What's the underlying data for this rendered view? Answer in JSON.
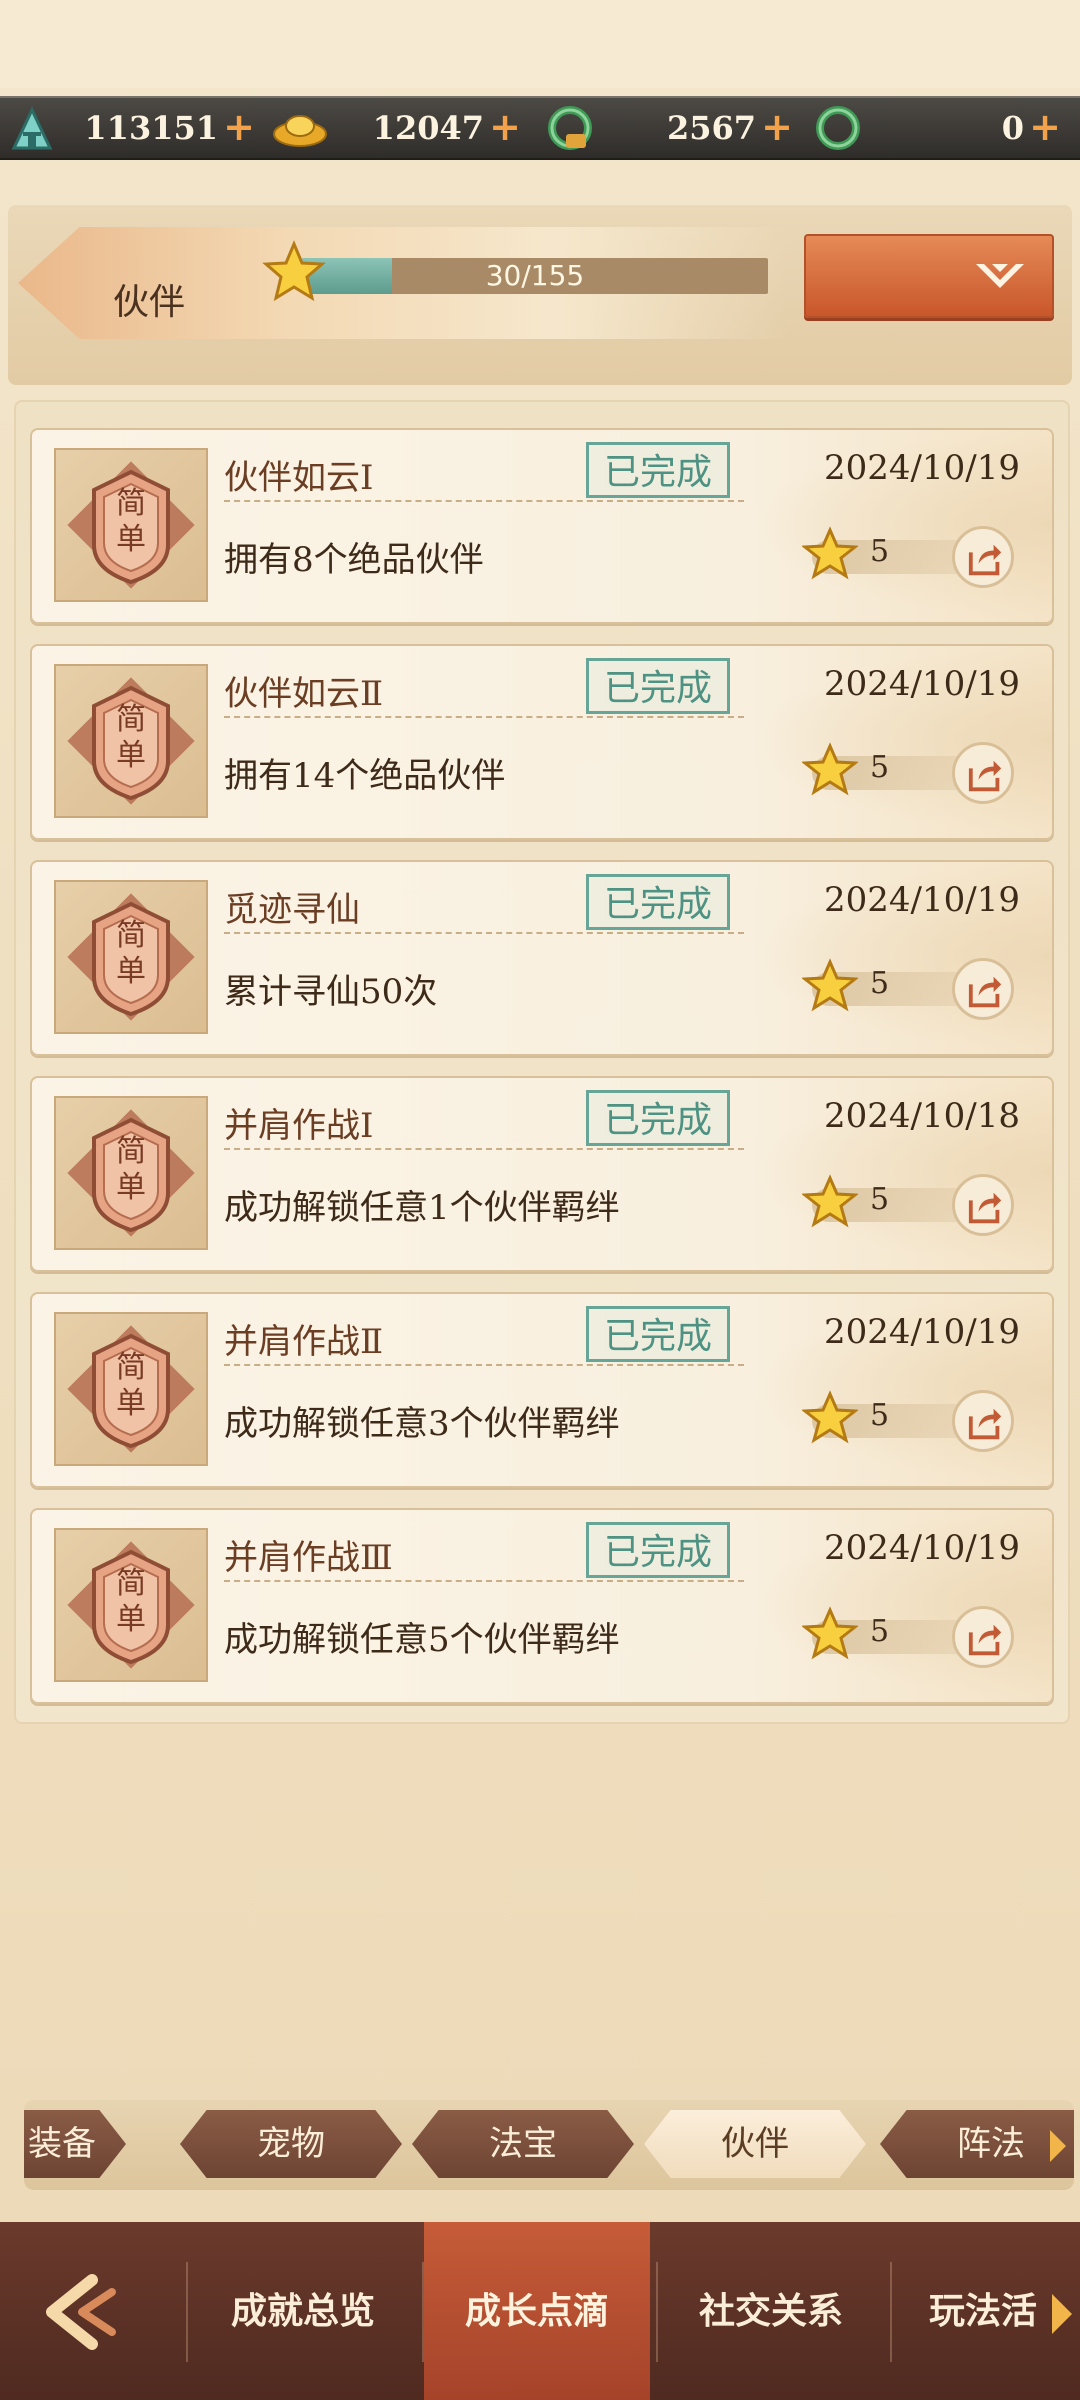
{
  "currencies": [
    {
      "icon": "jade-token-icon",
      "value": "113151"
    },
    {
      "icon": "gold-ingot-icon",
      "value": "12047"
    },
    {
      "icon": "bound-jade-ring-icon",
      "value": "2567"
    },
    {
      "icon": "jade-ring-icon",
      "value": "0"
    }
  ],
  "currency_plus": "+",
  "header": {
    "category_title": "伙伴",
    "progress_text": "30/155",
    "progress_current": 30,
    "progress_total": 155
  },
  "achievements": [
    {
      "name": "伙伴如云Ⅰ",
      "status": "已完成",
      "description": "拥有8个绝品伙伴",
      "date": "2024/10/19",
      "reward": "5",
      "badge": "简单"
    },
    {
      "name": "伙伴如云Ⅱ",
      "status": "已完成",
      "description": "拥有14个绝品伙伴",
      "date": "2024/10/19",
      "reward": "5",
      "badge": "简单"
    },
    {
      "name": "觅迹寻仙",
      "status": "已完成",
      "description": "累计寻仙50次",
      "date": "2024/10/19",
      "reward": "5",
      "badge": "简单"
    },
    {
      "name": "并肩作战Ⅰ",
      "status": "已完成",
      "description": "成功解锁任意1个伙伴羁绊",
      "date": "2024/10/18",
      "reward": "5",
      "badge": "简单"
    },
    {
      "name": "并肩作战Ⅱ",
      "status": "已完成",
      "description": "成功解锁任意3个伙伴羁绊",
      "date": "2024/10/19",
      "reward": "5",
      "badge": "简单"
    },
    {
      "name": "并肩作战Ⅲ",
      "status": "已完成",
      "description": "成功解锁任意5个伙伴羁绊",
      "date": "2024/10/19",
      "reward": "5",
      "badge": "简单"
    }
  ],
  "category_tabs": [
    {
      "label": "装备",
      "active": false
    },
    {
      "label": "宠物",
      "active": false
    },
    {
      "label": "法宝",
      "active": false
    },
    {
      "label": "伙伴",
      "active": true
    },
    {
      "label": "阵法",
      "active": false
    }
  ],
  "bottom_nav": [
    {
      "label": "成就总览",
      "active": false
    },
    {
      "label": "成长点滴",
      "active": true
    },
    {
      "label": "社交关系",
      "active": false
    },
    {
      "label": "玩法活",
      "active": false
    }
  ],
  "colors": {
    "accent_orange": "#c9572c",
    "completed_green": "#4d9283",
    "progress_teal": "#5d9c8e",
    "nav_dark": "#4f2a20"
  }
}
